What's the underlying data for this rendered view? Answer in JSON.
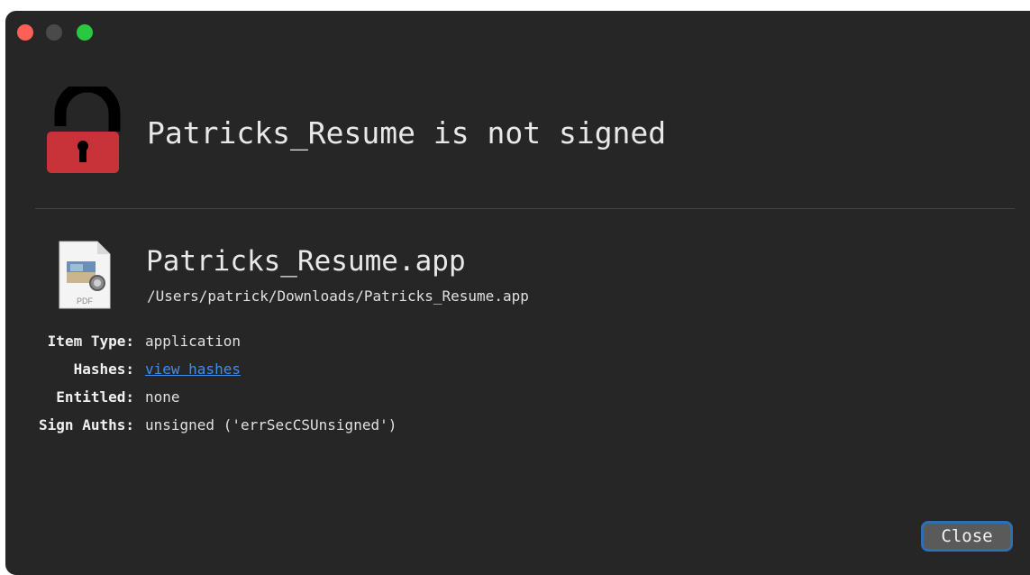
{
  "window": {
    "controls": {
      "close_icon": "close-circle-icon",
      "minimize_icon": "minimize-circle-icon",
      "zoom_icon": "zoom-circle-icon"
    }
  },
  "header": {
    "icon": "unlocked-padlock-icon",
    "title": "Patricks_Resume is not signed"
  },
  "file": {
    "icon": "pdf-document-icon",
    "icon_caption": "PDF",
    "name": "Patricks_Resume.app",
    "path": "/Users/patrick/Downloads/Patricks_Resume.app"
  },
  "details": [
    {
      "label": "Item Type:",
      "value": "application",
      "is_link": false
    },
    {
      "label": "Hashes:",
      "value": "view hashes",
      "is_link": true
    },
    {
      "label": "Entitled:",
      "value": "none",
      "is_link": false
    },
    {
      "label": "Sign Auths:",
      "value": "unsigned ('errSecCSUnsigned')",
      "is_link": false
    }
  ],
  "footer": {
    "close_label": "Close"
  },
  "colors": {
    "window_bg": "#262626",
    "lock_red": "#c8333a",
    "link": "#3d8ef0",
    "button_focus_ring": "#2d6fb4"
  }
}
